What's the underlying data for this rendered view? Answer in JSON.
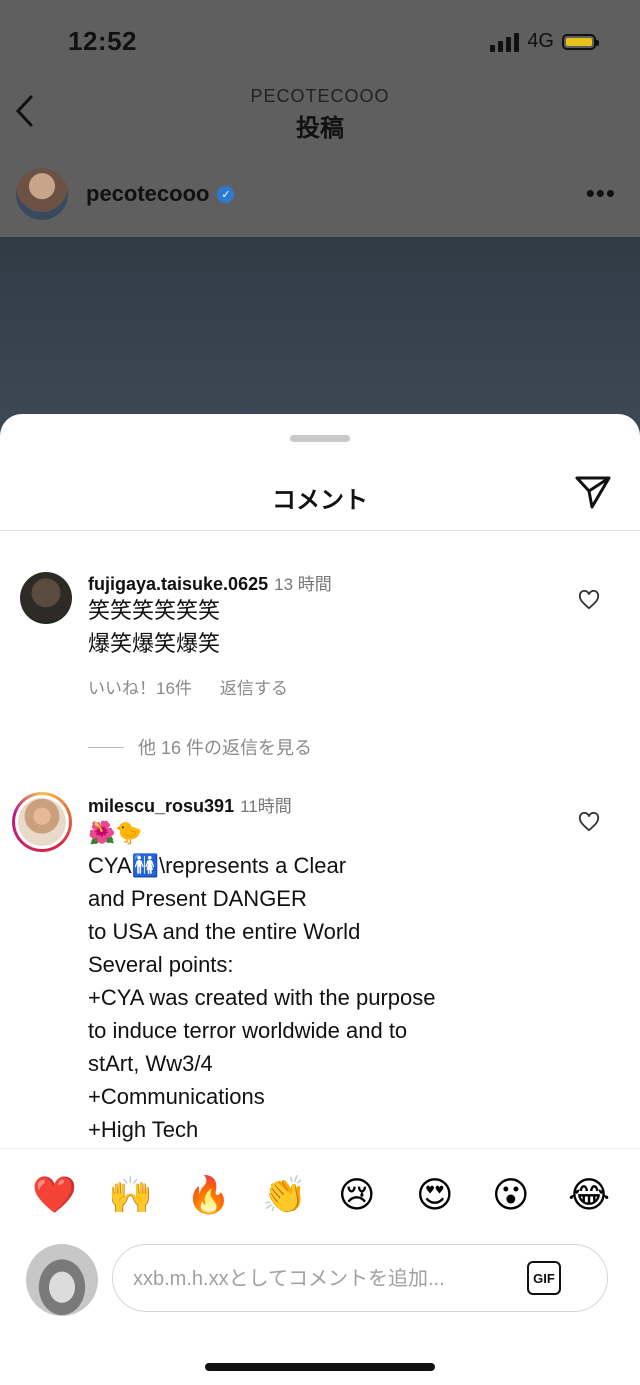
{
  "status_bar": {
    "time": "12:52",
    "network": "4G"
  },
  "header": {
    "account": "PECOTECOOO",
    "title": "投稿"
  },
  "post": {
    "username": "pecotecooo"
  },
  "sheet": {
    "title": "コメント"
  },
  "comments": [
    {
      "username": "fujigaya.taisuke.0625",
      "time": "13 時間",
      "text": "笑笑笑笑笑笑\n爆笑爆笑爆笑",
      "likes": "いいね！16件",
      "reply": "返信する",
      "view_replies": "他 16 件の返信を見る"
    },
    {
      "username": "milescu_rosu391",
      "time": "11時間",
      "text": "🌺🐤\nCYA🚻\\represents a Clear\nand Present DANGER\nto USA and the entire World\nSeveral points:\n+CYA was created with the purpose\nto induce terror worldwide and to\nstArt, Ww3/4\n+Communications\n+High Tech"
    }
  ],
  "emoji_bar": [
    "❤️",
    "🙌",
    "🔥",
    "👏",
    "😢",
    "😍",
    "😮",
    "😂"
  ],
  "comment_input": {
    "placeholder": "xxb.m.h.xxとしてコメントを追加...",
    "gif_label": "GIF"
  }
}
